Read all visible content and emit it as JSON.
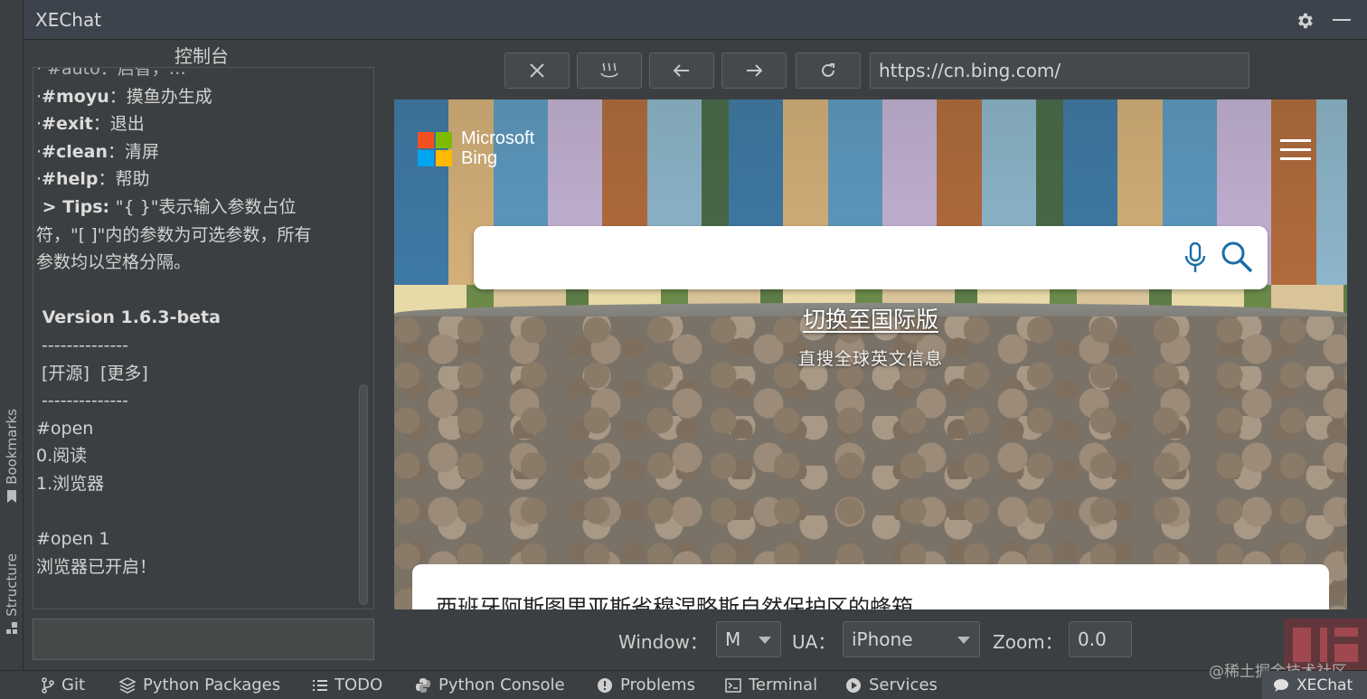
{
  "window": {
    "title": "XEChat"
  },
  "side_tabs": {
    "bookmarks": "Bookmarks",
    "structure": "Structure"
  },
  "console": {
    "title": "控制台",
    "lines": [
      {
        "pre": "·",
        "cmd": "#moyu",
        "text": "：摸鱼办生成"
      },
      {
        "pre": "·",
        "cmd": "#exit",
        "text": "：退出"
      },
      {
        "pre": "·",
        "cmd": "#clean",
        "text": "：清屏"
      },
      {
        "pre": "·",
        "cmd": "#help",
        "text": "：帮助"
      }
    ],
    "tips_label": " > Tips: ",
    "tips_1": "\"{ }\"表示输入参数占位",
    "tips_2": "符，\"[ ]\"内的参数为可选参数，所有",
    "tips_3": "参数均以空格分隔。",
    "version": " Version 1.6.3-beta",
    "divider": " --------------",
    "links": " [开源]  [更多]",
    "log": [
      "#open",
      "0.阅读",
      "1.浏览器",
      "",
      "#open 1",
      "浏览器已开启！"
    ]
  },
  "browser": {
    "url": "https://cn.bing.com/",
    "logo_line1": "Microsoft",
    "logo_line2": "Bing",
    "switch_intl": "切换至国际版",
    "switch_sub": "直搜全球英文信息",
    "card_title": "西班牙阿斯图里亚斯省穆涅略斯自然保护区的蜂箱"
  },
  "settings": {
    "window_label": "Window：",
    "window_value": "M",
    "ua_label": "UA：",
    "ua_value": "iPhone",
    "zoom_label": "Zoom：",
    "zoom_value": "0.0"
  },
  "statusbar": {
    "items": [
      "Git",
      "Python Packages",
      "TODO",
      "Python Console",
      "Problems",
      "Terminal",
      "Services"
    ],
    "active": "XEChat",
    "watermark": "@稀土掘金技术社区"
  }
}
